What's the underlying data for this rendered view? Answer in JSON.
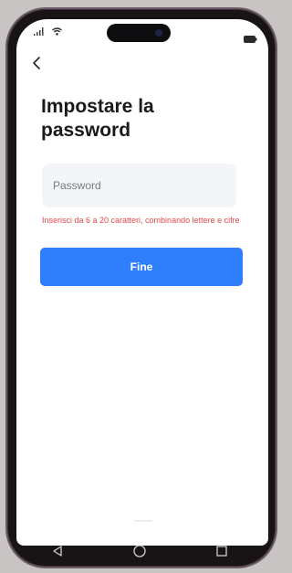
{
  "status_bar": {
    "signal_icon": "signal-icon",
    "wifi_icon": "wifi-icon",
    "battery_icon": "battery-icon"
  },
  "header": {
    "back_icon": "chevron-left-icon"
  },
  "page": {
    "title": "Impostare la password"
  },
  "form": {
    "password_placeholder": "Password",
    "password_value": "",
    "hint": "Inserisci da 6 a 20 caratteri, combinando lettere e cifre",
    "submit_label": "Fine"
  },
  "nav_bar": {
    "back_icon": "triangle-back-icon",
    "home_icon": "circle-home-icon",
    "recents_icon": "square-recents-icon"
  },
  "colors": {
    "accent": "#2f7ffc",
    "error": "#e5484d",
    "input_bg": "#f4f5f8",
    "frame": "#181416"
  }
}
